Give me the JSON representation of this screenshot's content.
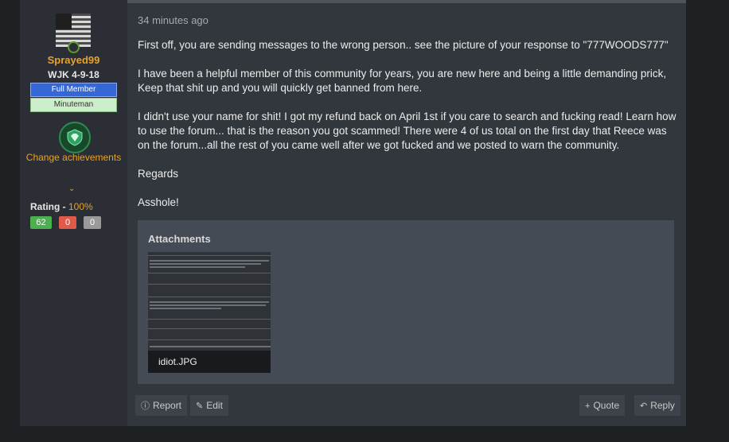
{
  "user": {
    "username": "Sprayed99",
    "title": "WJK 4-9-18",
    "banners": [
      "Full Member",
      "Minuteman"
    ],
    "change_achievements": "Change achievements",
    "rating_label": "Rating - ",
    "rating_pct": "100%",
    "rating_counts": [
      "62",
      "0",
      "0"
    ]
  },
  "post": {
    "timestamp": "34 minutes ago",
    "paragraphs": [
      "First off, you are sending messages to the wrong person.. see the picture of your response to \"777WOODS777\"",
      "I have been a helpful member of this community for years, you are new here and being a little demanding prick, Keep that shit up and you will quickly get banned from here.",
      "I didn't use your name for shit! I got my refund back on April 1st if you care to search and fucking read! Learn how to use the forum... that is the reason you got scammed! There were 4 of us total on the first day that Reece was on the forum...all the rest of you came well after we got fucked and we posted to warn the community.",
      "Regards",
      "Asshole!"
    ]
  },
  "attachments": {
    "title": "Attachments",
    "file_name": "idiot.JPG"
  },
  "actions": {
    "report": "Report",
    "edit": "Edit",
    "quote": "Quote",
    "reply": "Reply"
  },
  "icons": {
    "report": "report-icon",
    "edit": "edit-icon",
    "quote": "plus-icon",
    "reply": "reply-icon",
    "trophy": "shield-trophy-icon"
  },
  "colors": {
    "accent": "#e8a227",
    "full_member": "#3567d6",
    "minuteman": "#cdeecb",
    "rating_pos": "#4caf50",
    "rating_neu": "#e05a4a",
    "rating_neg": "#9a9a9a"
  }
}
